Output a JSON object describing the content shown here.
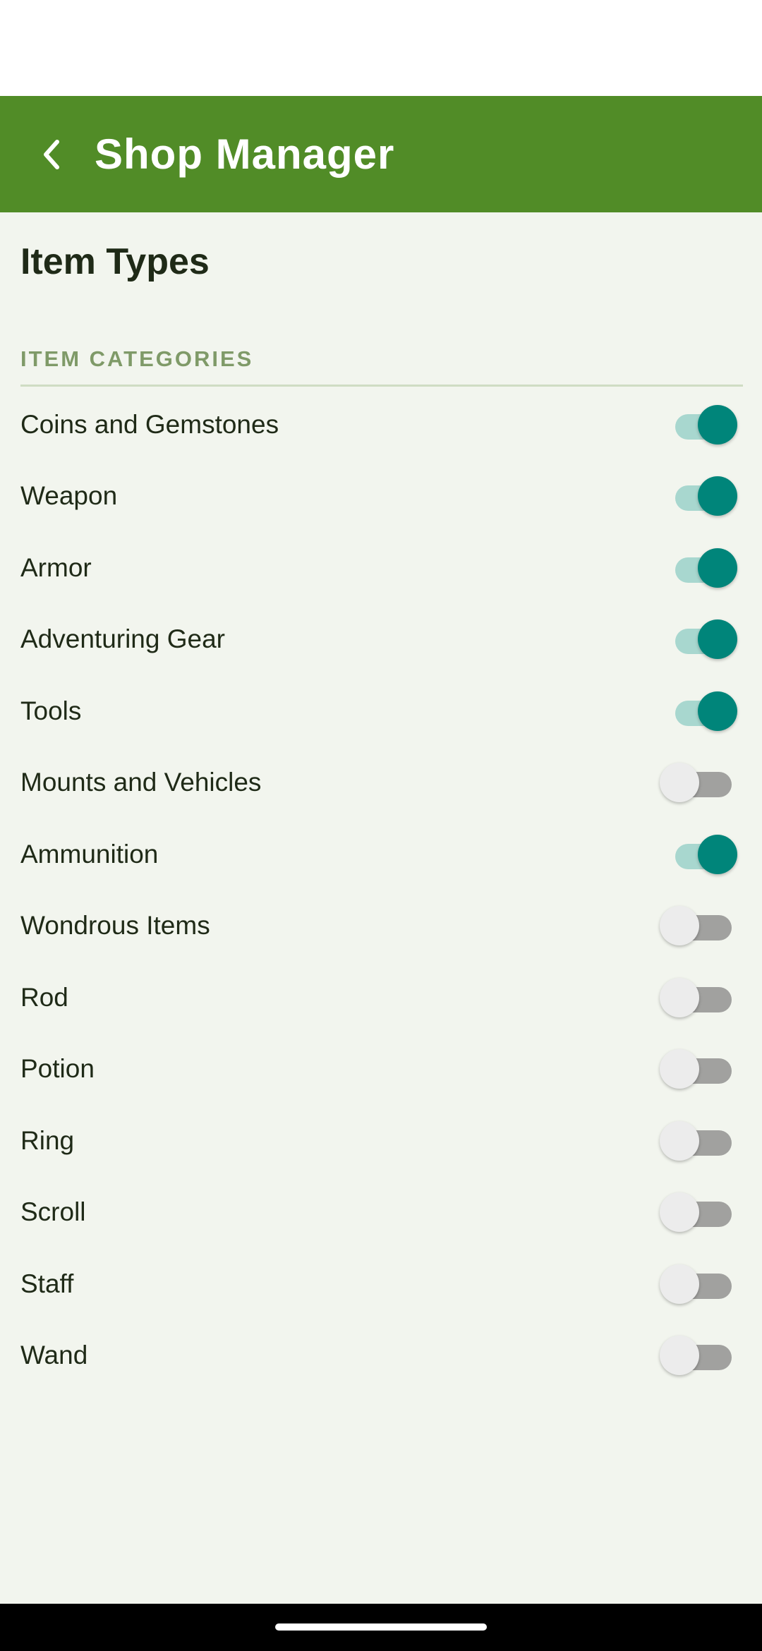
{
  "app_bar": {
    "title": "Shop Manager"
  },
  "page": {
    "title": "Item Types"
  },
  "section": {
    "header": "ITEM CATEGORIES"
  },
  "items": [
    {
      "label": "Coins and Gemstones",
      "enabled": true
    },
    {
      "label": "Weapon",
      "enabled": true
    },
    {
      "label": "Armor",
      "enabled": true
    },
    {
      "label": "Adventuring Gear",
      "enabled": true
    },
    {
      "label": "Tools",
      "enabled": true
    },
    {
      "label": "Mounts and Vehicles",
      "enabled": false
    },
    {
      "label": "Ammunition",
      "enabled": true
    },
    {
      "label": "Wondrous Items",
      "enabled": false
    },
    {
      "label": "Rod",
      "enabled": false
    },
    {
      "label": "Potion",
      "enabled": false
    },
    {
      "label": "Ring",
      "enabled": false
    },
    {
      "label": "Scroll",
      "enabled": false
    },
    {
      "label": "Staff",
      "enabled": false
    },
    {
      "label": "Wand",
      "enabled": false
    }
  ],
  "colors": {
    "app_bar": "#518c27",
    "switch_on": "#00857a",
    "switch_on_track": "#a8d7cf",
    "background": "#f2f5ee"
  }
}
